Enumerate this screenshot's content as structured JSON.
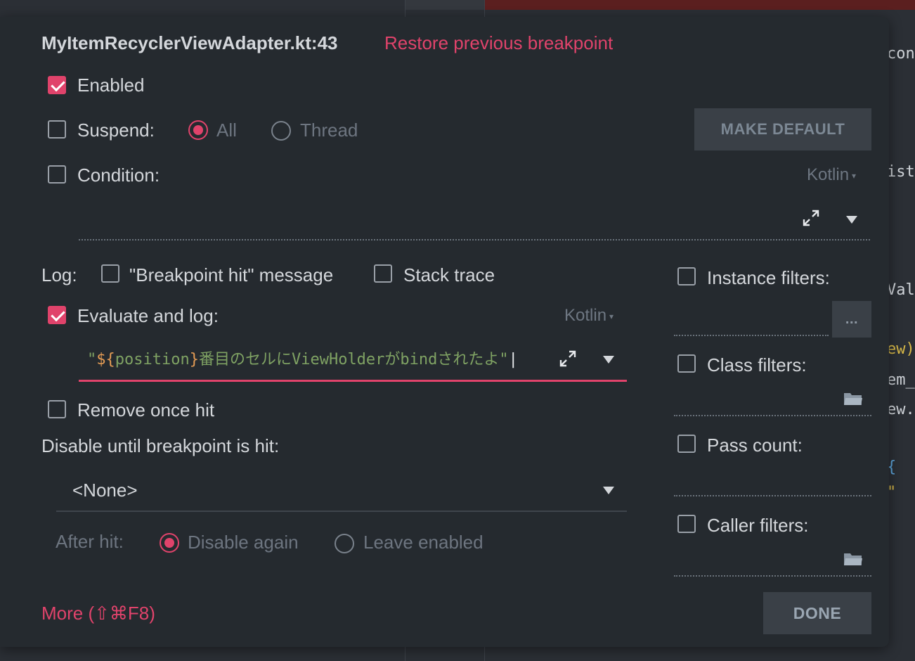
{
  "dialog": {
    "title": "MyItemRecyclerViewAdapter.kt:43",
    "restore_link": "Restore previous breakpoint",
    "enabled": {
      "label": "Enabled",
      "checked": true
    },
    "suspend": {
      "label": "Suspend:",
      "checked": false,
      "options": [
        {
          "label": "All",
          "selected": true
        },
        {
          "label": "Thread",
          "selected": false
        }
      ]
    },
    "make_default_label": "MAKE DEFAULT",
    "condition": {
      "label": "Condition:",
      "checked": false,
      "language": "Kotlin"
    },
    "log": {
      "label": "Log:",
      "breakpoint_hit": {
        "label": "\"Breakpoint hit\" message",
        "checked": false
      },
      "stack_trace": {
        "label": "Stack trace",
        "checked": false
      }
    },
    "evaluate_and_log": {
      "label": "Evaluate and log:",
      "checked": true,
      "language": "Kotlin",
      "expression_prefix": "\"",
      "expression_brace_open": "${",
      "expression_ident": "position",
      "expression_brace_close": "}",
      "expression_rest": "番目のセルにViewHolderがbindされたよ\""
    },
    "remove_once_hit": {
      "label": "Remove once hit",
      "checked": false
    },
    "disable_until": {
      "label": "Disable until breakpoint is hit:",
      "value": "<None>"
    },
    "after_hit": {
      "label": "After hit:",
      "options": [
        {
          "label": "Disable again",
          "selected": true
        },
        {
          "label": "Leave enabled",
          "selected": false
        }
      ]
    },
    "filters": {
      "instance": {
        "label": "Instance filters:",
        "checked": false,
        "button": "..."
      },
      "class": {
        "label": "Class filters:",
        "checked": false
      },
      "pass_count": {
        "label": "Pass count:",
        "checked": false
      },
      "caller": {
        "label": "Caller filters:",
        "checked": false
      }
    },
    "more_link": "More (⇧⌘F8)",
    "done_label": "DONE"
  },
  "colors": {
    "accent": "#e0436b",
    "panel": "#252a2f",
    "button": "#3a4047"
  }
}
